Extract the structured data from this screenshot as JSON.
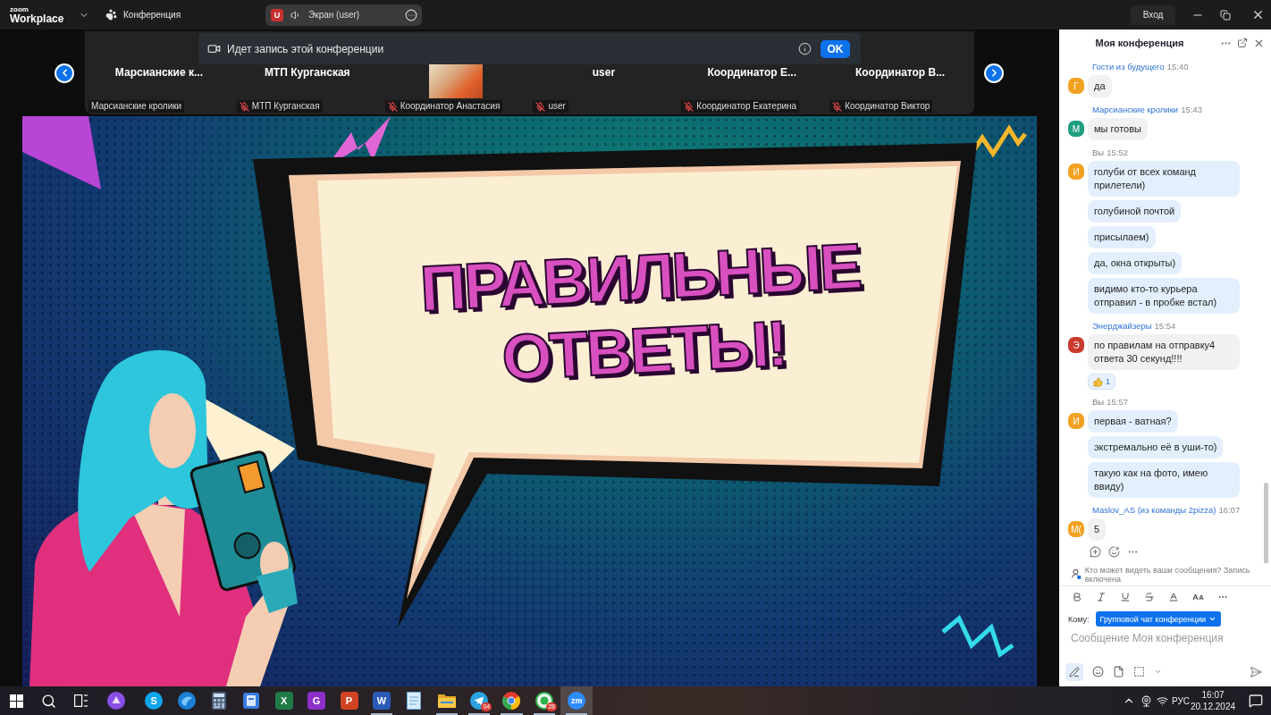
{
  "top_bar": {
    "logo": {
      "brand": "zoom",
      "product": "Workplace"
    },
    "meeting_menu": "Конференция",
    "share_pill": {
      "avatar": "U",
      "label": "Экран (user)"
    },
    "sign_in": "Вход"
  },
  "participant_strip": {
    "recording_banner": {
      "text": "Идет запись этой конференции",
      "button": "OK"
    },
    "participants": [
      {
        "kind": "name",
        "title": "Марсианские к...",
        "label": "Марсианские кролики",
        "muted": false
      },
      {
        "kind": "name",
        "title": "МТП Курганская",
        "label": "МТП Курганская",
        "muted": true
      },
      {
        "kind": "video",
        "label": "Координатор Анастасия",
        "muted": true
      },
      {
        "kind": "name",
        "title": "user",
        "label": "user",
        "muted": true
      },
      {
        "kind": "name",
        "title": "Координатор Е...",
        "label": "Координатор Екатерина",
        "muted": true
      },
      {
        "kind": "name",
        "title": "Координатор В...",
        "label": "Координатор Виктор",
        "muted": true
      }
    ]
  },
  "shared_screen": {
    "headline": "ПРАВИЛЬНЫЕ ОТВЕТЫ!"
  },
  "chat": {
    "title": "Моя конференция",
    "groups": [
      {
        "sender": "Гости из будущего",
        "time": "15:40",
        "own": false,
        "avatar": "Г",
        "color": "#f2a222",
        "messages": [
          "да"
        ]
      },
      {
        "sender": "Марсианские кролики",
        "time": "15:43",
        "own": false,
        "avatar": "М",
        "color": "#1f9e80",
        "messages": [
          "мы готовы"
        ]
      },
      {
        "sender": "Вы",
        "time": "15:52",
        "own": true,
        "avatar": "И",
        "color": "#f2a222",
        "messages": [
          "голуби от всех команд прилетели)",
          "голубиной почтой",
          "присылаем)",
          "да, окна открыты)",
          "видимо кто-то курьера отправил - в пробке встал)"
        ]
      },
      {
        "sender": "Энерджайзеры",
        "time": "15:54",
        "own": false,
        "avatar": "Э",
        "color": "#c8392e",
        "messages": [
          "по правилам на отправку4 ответа 30 секунд!!!!"
        ],
        "reaction": {
          "count": "1"
        }
      },
      {
        "sender": "Вы",
        "time": "15:57",
        "own": true,
        "avatar": "И",
        "color": "#f2a222",
        "messages": [
          "первая - ватная?",
          "экстремально её в уши-то)",
          "такую как на фото, имею ввиду)"
        ]
      },
      {
        "sender": "Maslov_AS (из команды 2pizza)",
        "time": "16:07",
        "own": false,
        "avatar": "М(",
        "color": "#f2a222",
        "messages": [
          "5"
        ]
      }
    ],
    "notice": "Кто может видеть ваши сообщения? Запись включена",
    "composer": {
      "formatting_on": true,
      "to_label": "Кому:",
      "recipient": "Групповой чат конференции",
      "placeholder": "Сообщение Моя конференция"
    }
  },
  "taskbar": {
    "apps": [
      {
        "kind": "orb",
        "running": false,
        "active": false
      },
      {
        "kind": "lettercircle",
        "glyph": "S",
        "running": false,
        "active": false
      },
      {
        "kind": "globe",
        "running": false,
        "active": false
      },
      {
        "kind": "calculator",
        "running": false,
        "active": false
      },
      {
        "kind": "book",
        "running": false,
        "active": false
      },
      {
        "kind": "sheet",
        "glyph": "X",
        "running": false,
        "active": false
      },
      {
        "kind": "lettersquare",
        "glyph": "G",
        "running": false,
        "active": false
      },
      {
        "kind": "slides",
        "glyph": "P",
        "running": false,
        "active": false
      },
      {
        "kind": "doc",
        "glyph": "W",
        "running": true,
        "active": false
      },
      {
        "kind": "notepad",
        "running": false,
        "active": false
      },
      {
        "kind": "folder",
        "running": true,
        "active": false
      },
      {
        "kind": "plane",
        "badge": "04",
        "running": true,
        "active": false
      },
      {
        "kind": "browser",
        "running": true,
        "active": false
      },
      {
        "kind": "phonechat",
        "badge": "28",
        "running": true,
        "active": false
      },
      {
        "kind": "meeting",
        "glyph": "zm",
        "running": true,
        "active": true
      }
    ],
    "tray": {
      "language": "РУС",
      "time": "16:07",
      "date": "20.12.2024"
    }
  }
}
